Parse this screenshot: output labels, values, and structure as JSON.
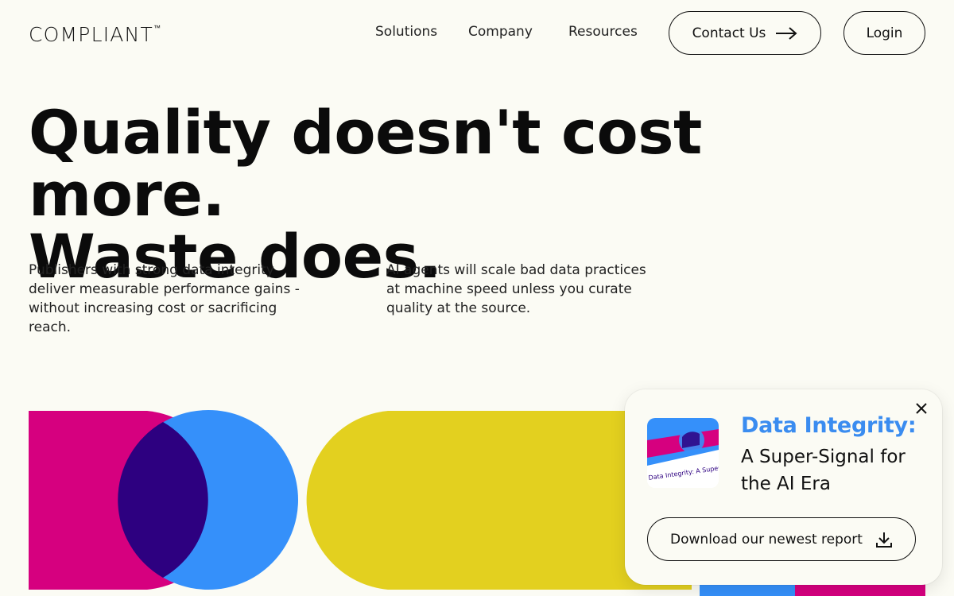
{
  "brand": {
    "name": "COMPLIANT",
    "mark": "™"
  },
  "nav": {
    "items": [
      {
        "label": "Solutions"
      },
      {
        "label": "Company"
      },
      {
        "label": "Resources"
      }
    ],
    "contact_label": "Contact Us",
    "login_label": "Login"
  },
  "hero": {
    "headline_line1": "Quality doesn't cost more.",
    "headline_line2": "Waste does.",
    "paragraph_left": "Publishers with strong data integrity deliver measurable performance gains -without increasing cost or sacrificing reach.",
    "paragraph_right": "AI agents will scale bad data practices at machine speed unless you curate quality at the source."
  },
  "popup": {
    "title": "Data Integrity:",
    "subtitle": "A Super-Signal for the AI Era",
    "download_label": "Download our newest report",
    "thumbnail_text": "Data Integrity: A Super",
    "close_icon": "close-icon",
    "download_icon": "download-icon"
  },
  "colors": {
    "background": "#fbfbf4",
    "magenta": "#d6007f",
    "blue": "#3590fa",
    "overlap": "#2d0080",
    "yellow": "#e3d01f",
    "accent_text": "#3a8cf0"
  }
}
